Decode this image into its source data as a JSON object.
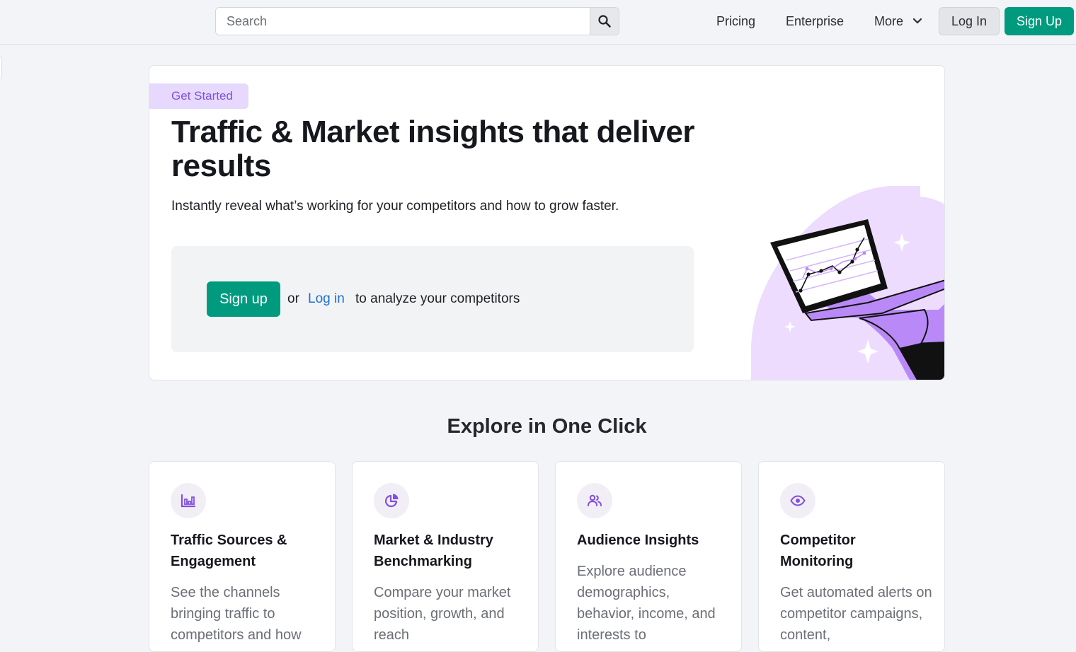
{
  "header": {
    "search": {
      "placeholder": "Search",
      "value": ""
    },
    "nav": {
      "pricing": "Pricing",
      "enterprise": "Enterprise",
      "more": "More"
    },
    "login_label": "Log In",
    "signup_label": "Sign Up"
  },
  "hero": {
    "tag": "Get Started",
    "title": "Traffic & Market insights that deliver results",
    "subtitle": "Instantly reveal what’s working for your competitors and how to grow faster.",
    "cta": {
      "signup": "Sign up",
      "or": "or",
      "login": "Log in",
      "rest": "to analyze your competitors"
    }
  },
  "explore": {
    "title": "Explore in One Click",
    "cards": [
      {
        "icon": "bar-chart-icon",
        "title": "Traffic Sources & Engagement",
        "desc": "See the channels bringing traffic to competitors and how"
      },
      {
        "icon": "pie-chart-icon",
        "title": "Market & Industry Benchmarking",
        "desc": "Compare your market position, growth, and reach"
      },
      {
        "icon": "users-icon",
        "title": "Audience Insights",
        "desc": "Explore audience demographics, behavior, income, and interests to"
      },
      {
        "icon": "eye-icon",
        "title": "Competitor Monitoring",
        "desc": "Get automated alerts on competitor campaigns, content,"
      }
    ]
  },
  "colors": {
    "accent": "#009b7f",
    "purple": "#8250df",
    "link": "#1a6fd4"
  }
}
